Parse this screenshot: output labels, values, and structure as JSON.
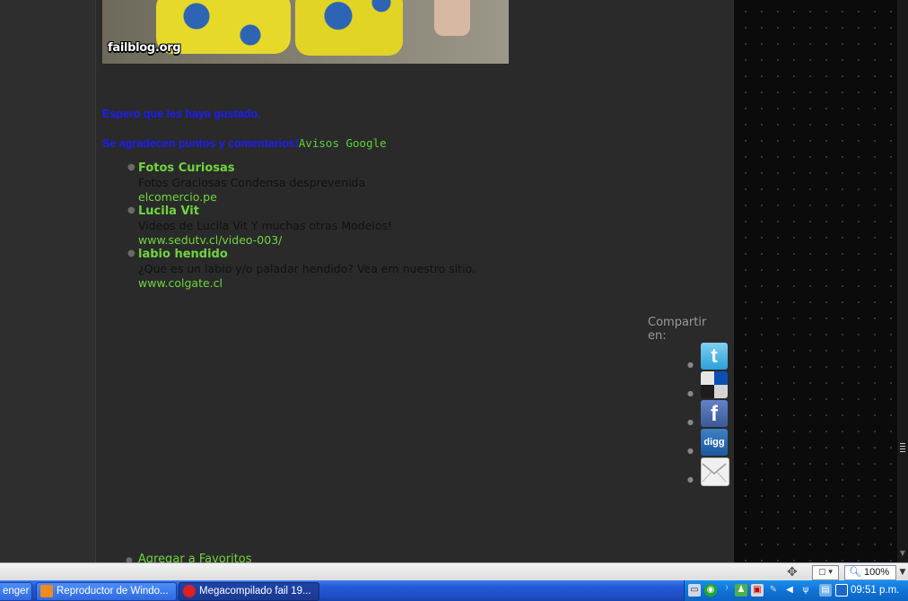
{
  "photo": {
    "watermark": "failblog.org"
  },
  "content": {
    "line1": "Espero que les haya gustado.",
    "line2": "Se agradecen puntos y comentarios!",
    "ads_label": "Avisos Google"
  },
  "ads": [
    {
      "title": "Fotos Curiosas",
      "desc": "Fotos Graciosas Condensa desprevenida",
      "url": "elcomercio.pe"
    },
    {
      "title": "Lucila Vit",
      "desc": "Videos de Lucila Vit Y muchas otras Modelos!",
      "url": "www.sedutv.cl/video-003/"
    },
    {
      "title": "labio hendido",
      "desc": "¿Qué es un labio y/o paladar hendido? Vea em nuestro sitio.",
      "url": "www.colgate.cl"
    }
  ],
  "share": {
    "label": "Compartir en:",
    "items": [
      {
        "name": "twitter",
        "icon": "twitter-icon",
        "glyph": "t"
      },
      {
        "name": "delicious",
        "icon": "delicious-icon",
        "glyph": ""
      },
      {
        "name": "facebook",
        "icon": "facebook-icon",
        "glyph": "f"
      },
      {
        "name": "digg",
        "icon": "digg-icon",
        "glyph": "digg"
      },
      {
        "name": "email",
        "icon": "mail-icon",
        "glyph": ""
      }
    ]
  },
  "favorites": {
    "label": "Agregar a Favoritos"
  },
  "statusbar": {
    "zoom": "100%"
  },
  "taskbar": {
    "buttons": [
      {
        "label": "enger",
        "active": false
      },
      {
        "label": "Reproductor de Windo...",
        "active": false
      },
      {
        "label": "Megacompilado fail 19...",
        "active": true
      }
    ],
    "clock": "09:51 p.m."
  },
  "colors": {
    "accent_green": "#6fd53f",
    "link_blue": "#1c1cff",
    "page_bg": "#2a2a2a",
    "taskbar_blue": "#2559d8"
  }
}
